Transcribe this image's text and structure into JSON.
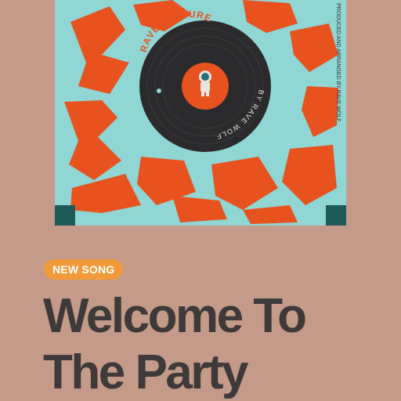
{
  "cover": {
    "label_title": "RAVE CULTURE",
    "label_artist": "BY RAVE WOLF",
    "credit_text": "PRODUCED AND ARRANGED BY RAVE WOLF",
    "colors": {
      "background": "#8fd6d4",
      "lettering": "#e8521f",
      "vinyl": "#2b2a2c",
      "label": "#e8521f",
      "corner_blocks": "#1f5a5a"
    }
  },
  "badge": {
    "label": "NEW SONG",
    "color": "#f29a3a"
  },
  "title": {
    "line1": "Welcome To",
    "line2": "The Party"
  },
  "page": {
    "background": "#c49a88",
    "text_color": "#3d3a39"
  }
}
